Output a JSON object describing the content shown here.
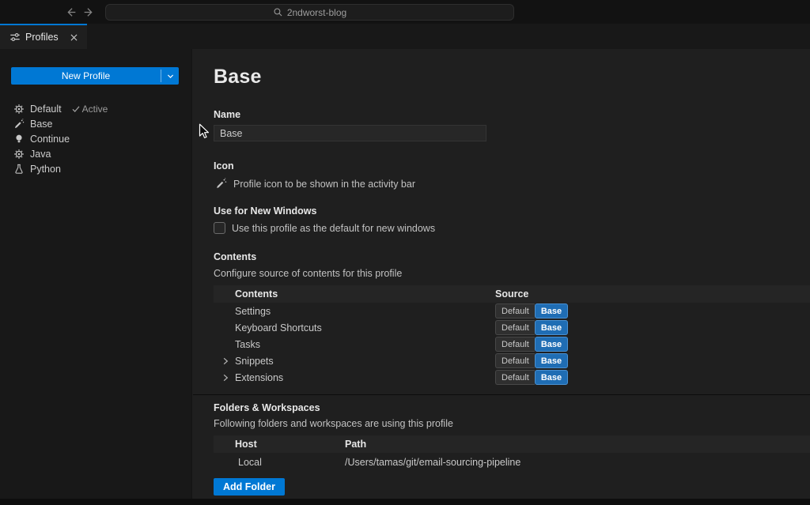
{
  "titlebar": {
    "search_value": "2ndworst-blog"
  },
  "tab": {
    "label": "Profiles"
  },
  "sidebar": {
    "new_profile_label": "New Profile",
    "profiles": [
      {
        "label": "Default",
        "icon": "gear-icon",
        "badge": "Active"
      },
      {
        "label": "Base",
        "icon": "pencil-icon"
      },
      {
        "label": "Continue",
        "icon": "lightbulb-icon"
      },
      {
        "label": "Java",
        "icon": "gear-icon"
      },
      {
        "label": "Python",
        "icon": "beaker-icon"
      }
    ]
  },
  "main": {
    "title": "Base",
    "name_section": {
      "label": "Name",
      "value": "Base"
    },
    "icon_section": {
      "label": "Icon",
      "description": "Profile icon to be shown in the activity bar"
    },
    "new_windows_section": {
      "label": "Use for New Windows",
      "checkbox_label": "Use this profile as the default for new windows",
      "checked": false
    },
    "contents_section": {
      "label": "Contents",
      "description": "Configure source of contents for this profile",
      "columns": [
        "Contents",
        "Source"
      ],
      "rows": [
        {
          "label": "Settings",
          "expandable": false,
          "options": [
            "Default",
            "Base"
          ],
          "selected": "Base"
        },
        {
          "label": "Keyboard Shortcuts",
          "expandable": false,
          "options": [
            "Default",
            "Base"
          ],
          "selected": "Base"
        },
        {
          "label": "Tasks",
          "expandable": false,
          "options": [
            "Default",
            "Base"
          ],
          "selected": "Base"
        },
        {
          "label": "Snippets",
          "expandable": true,
          "options": [
            "Default",
            "Base"
          ],
          "selected": "Base"
        },
        {
          "label": "Extensions",
          "expandable": true,
          "options": [
            "Default",
            "Base"
          ],
          "selected": "Base"
        }
      ]
    },
    "folders_section": {
      "label": "Folders & Workspaces",
      "description": "Following folders and workspaces are using this profile",
      "columns": [
        "Host",
        "Path"
      ],
      "rows": [
        {
          "host": "Local",
          "path": "/Users/tamas/git/email-sourcing-pipeline"
        }
      ],
      "add_folder_label": "Add Folder"
    }
  },
  "icons": {
    "profiles_tab": "tune-sliders",
    "search": "magnifier",
    "back": "arrow-left",
    "forward": "arrow-right",
    "new_profile_dropdown": "chevron-down",
    "active_badge": "check",
    "expandable_row": "chevron-right",
    "close_tab": "x"
  },
  "colors": {
    "accent": "#0078d4",
    "selected_source": "#1f6db4",
    "titlebar_bg": "#121212",
    "sidebar_bg": "#181818",
    "editor_bg": "#1f1f1f"
  }
}
